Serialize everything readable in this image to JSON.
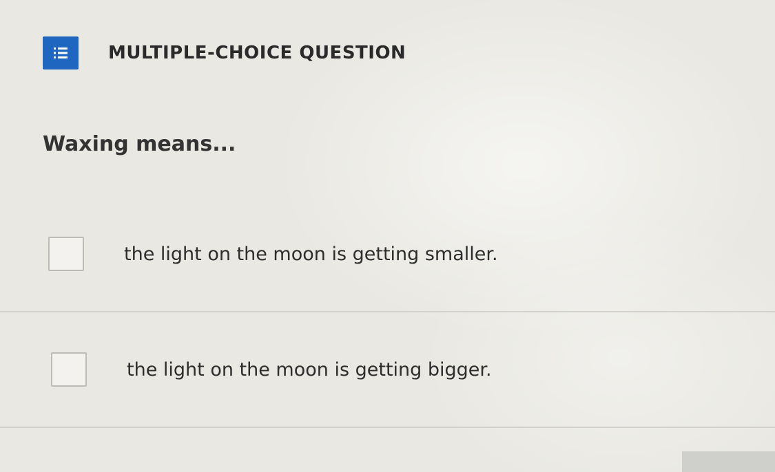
{
  "question_card": {
    "type_label": "MULTIPLE-CHOICE QUESTION",
    "type_icon": "list-icon",
    "accent_color": "#1f66c0",
    "prompt": "Waxing means...",
    "options": [
      {
        "label": "the light on the moon is getting smaller.",
        "checked": false
      },
      {
        "label": "the light on the moon is getting bigger.",
        "checked": false
      }
    ]
  }
}
